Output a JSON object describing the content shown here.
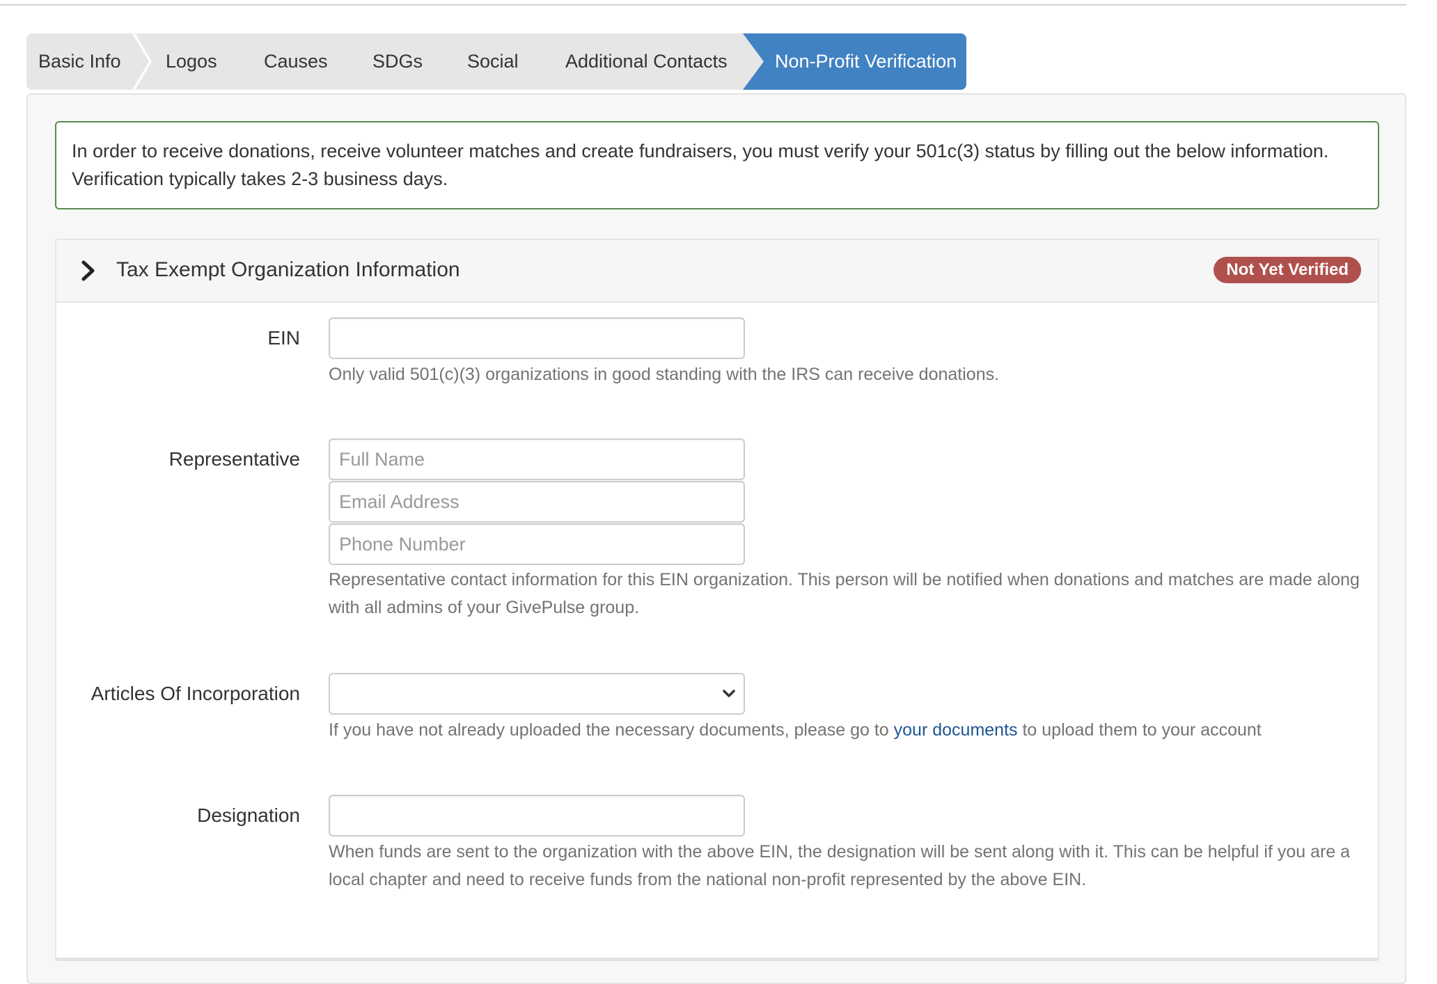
{
  "tabs": [
    {
      "label": "Basic Info",
      "active": false
    },
    {
      "label": "Logos",
      "active": false
    },
    {
      "label": "Causes",
      "active": false
    },
    {
      "label": "SDGs",
      "active": false
    },
    {
      "label": "Social",
      "active": false
    },
    {
      "label": "Additional Contacts",
      "active": false
    },
    {
      "label": "Non-Profit Verification",
      "active": true
    }
  ],
  "alert": {
    "text": "In order to receive donations, receive volunteer matches and create fundraisers, you must verify your 501c(3) status by filling out the below information. Verification typically takes 2-3 business days."
  },
  "section": {
    "title": "Tax Exempt Organization Information",
    "status_badge": "Not Yet Verified",
    "expanded_icon": "chevron-right-icon"
  },
  "form": {
    "ein": {
      "label": "EIN",
      "value": "",
      "placeholder": "",
      "help": "Only valid 501(c)(3) organizations in good standing with the IRS can receive donations."
    },
    "representative": {
      "label": "Representative",
      "full_name_placeholder": "Full Name",
      "email_placeholder": "Email Address",
      "phone_placeholder": "Phone Number",
      "help": "Representative contact information for this EIN organization. This person will be notified when donations and matches are made along with all admins of your GivePulse group."
    },
    "articles": {
      "label": "Articles Of Incorporation",
      "selected": "",
      "help_before": "If you have not already uploaded the necessary documents, please go to ",
      "help_link": "your documents",
      "help_after": " to upload them to your account"
    },
    "designation": {
      "label": "Designation",
      "value": "",
      "help": "When funds are sent to the organization with the above EIN, the designation will be sent along with it. This can be helpful if you are a local chapter and need to receive funds from the national non-profit represented by the above EIN."
    }
  },
  "colors": {
    "active_tab": "#4182c2",
    "inactive_tab": "#e6e6e6",
    "alert_border": "#5a8a4f",
    "badge": "#b0504d",
    "link": "#1e5593"
  }
}
